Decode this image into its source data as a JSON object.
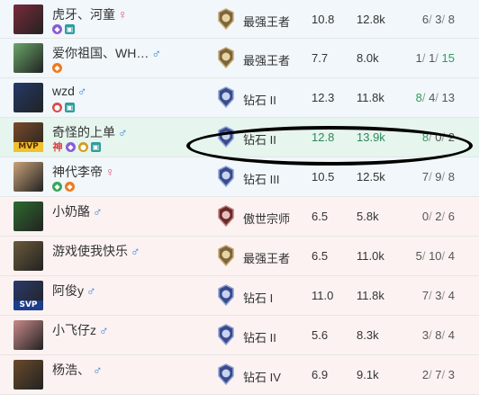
{
  "players": [
    {
      "name": "虎牙、河童",
      "gender": "♀",
      "rank": "最强王者",
      "rank_tier": "challenger",
      "kda_ratio": "10.8",
      "damage": "12.8k",
      "k": "6",
      "d": "3",
      "a": "8",
      "row_tint": "blue",
      "badges": [
        "purple",
        "teal"
      ],
      "avatar_color": "#7a2a3a"
    },
    {
      "name": "爱你祖国、WH…",
      "gender": "♂",
      "rank": "最强王者",
      "rank_tier": "challenger",
      "kda_ratio": "7.7",
      "damage": "8.0k",
      "k": "1",
      "d": "1",
      "a": "15",
      "row_tint": "blue",
      "badges": [
        "orange"
      ],
      "avatar_color": "#6aa66a"
    },
    {
      "name": "wzd",
      "gender": "♂",
      "rank": "钻石 II",
      "rank_tier": "diamond",
      "kda_ratio": "12.3",
      "damage": "11.8k",
      "k": "8",
      "d": "4",
      "a": "13",
      "row_tint": "blue",
      "badges": [
        "red",
        "teal"
      ],
      "avatar_color": "#233a6a"
    },
    {
      "name": "奇怪的上单",
      "gender": "♂",
      "rank": "钻石 II",
      "rank_tier": "diamond",
      "kda_ratio": "12.8",
      "damage": "13.9k",
      "k": "8",
      "d": "0",
      "a": "2",
      "row_tint": "green",
      "badges": [
        "shen",
        "purple",
        "gold",
        "teal"
      ],
      "avatar_color": "#7a4a2a",
      "mvp": "MVP"
    },
    {
      "name": "神代李帝",
      "gender": "♀",
      "rank": "钻石 III",
      "rank_tier": "diamond",
      "kda_ratio": "10.5",
      "damage": "12.5k",
      "k": "7",
      "d": "9",
      "a": "8",
      "row_tint": "blue",
      "badges": [
        "green",
        "orange"
      ],
      "avatar_color": "#c9a27a"
    },
    {
      "name": "小奶酪",
      "gender": "♂",
      "rank": "傲世宗师",
      "rank_tier": "grandmaster",
      "kda_ratio": "6.5",
      "damage": "5.8k",
      "k": "0",
      "d": "2",
      "a": "6",
      "row_tint": "pink",
      "badges": [],
      "avatar_color": "#2e6a2e"
    },
    {
      "name": "游戏使我快乐",
      "gender": "♂",
      "rank": "最强王者",
      "rank_tier": "challenger",
      "kda_ratio": "6.5",
      "damage": "11.0k",
      "k": "5",
      "d": "10",
      "a": "4",
      "row_tint": "pink",
      "badges": [],
      "avatar_color": "#6a5a3a"
    },
    {
      "name": "阿俊y",
      "gender": "♂",
      "rank": "钻石 I",
      "rank_tier": "diamond",
      "kda_ratio": "11.0",
      "damage": "11.8k",
      "k": "7",
      "d": "3",
      "a": "4",
      "row_tint": "pink",
      "badges": [],
      "avatar_color": "#2a3a6a",
      "mvp": "SVP"
    },
    {
      "name": "小飞仔z",
      "gender": "♂",
      "rank": "钻石 II",
      "rank_tier": "diamond",
      "kda_ratio": "5.6",
      "damage": "8.3k",
      "k": "3",
      "d": "8",
      "a": "4",
      "row_tint": "pink",
      "badges": [],
      "avatar_color": "#c98a8a"
    },
    {
      "name": "杨浩、",
      "gender": "♂",
      "rank": "钻石 IV",
      "rank_tier": "diamond",
      "kda_ratio": "6.9",
      "damage": "9.1k",
      "k": "2",
      "d": "7",
      "a": "3",
      "row_tint": "pink",
      "badges": [],
      "avatar_color": "#6a4a2a"
    }
  ],
  "badge_glyphs": {
    "shen": "神",
    "purple": "◆",
    "orange": "◆",
    "teal": "▣",
    "red": "●",
    "green": "◆",
    "gold": "●"
  },
  "colors": {
    "male": "#2f7fd6",
    "female": "#e0507e",
    "highlight_assists": "#2f9e5a",
    "annotation_circle": "#000000"
  }
}
